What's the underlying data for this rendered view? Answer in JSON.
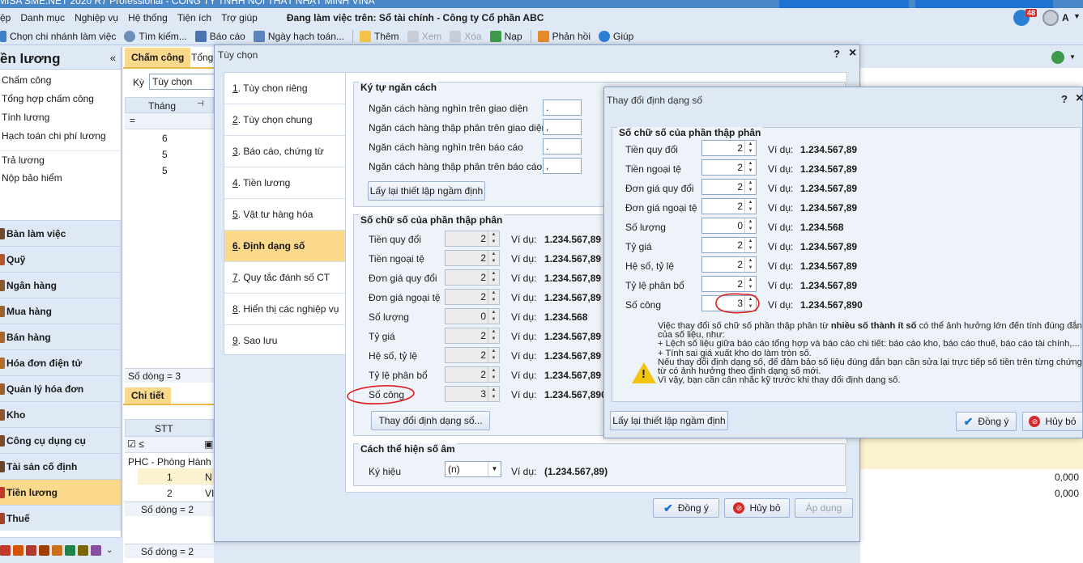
{
  "app": {
    "title_partial": "MISA SME.NET 2020 R7 Professional - CÔNG TY TNHH NỘI THẤT NHẬT MINH VINA"
  },
  "menubar": {
    "items": [
      "ệp",
      "Danh mục",
      "Nghiệp vụ",
      "Hệ thống",
      "Tiện ích",
      "Trợ giúp"
    ],
    "working_on": "Đang làm việc trên: Sổ tài chính - Công ty Cổ phần ABC",
    "notif_count": "48",
    "user": "A"
  },
  "toolbar": {
    "branch": "Chọn chi nhánh làm việc",
    "search": "Tìm kiếm...",
    "report": "Báo cáo",
    "post_date": "Ngày hạch toán...",
    "add": "Thêm",
    "view": "Xem",
    "delete": "Xóa",
    "load": "Nạp",
    "feedback": "Phản hồi",
    "help": "Giúp"
  },
  "left_panel": {
    "title": "ền lương",
    "collapse": "«",
    "links": [
      "Chấm công",
      "Tổng hợp chấm công",
      "Tính lương",
      "Hạch toán chi phí lương",
      "Trả lương",
      "Nộp bảo hiểm"
    ],
    "nav": [
      "Bàn làm việc",
      "Quỹ",
      "Ngân hàng",
      "Mua hàng",
      "Bán hàng",
      "Hóa đơn điện tử",
      "Quản lý hóa đơn",
      "Kho",
      "Công cụ dụng cụ",
      "Tài sản cố định",
      "Tiền lương",
      "Thuế"
    ],
    "selected_nav": "Tiền lương"
  },
  "mid": {
    "tab_active": "Chấm công",
    "tab_other": "Tổng",
    "period_label": "Kỳ",
    "period_value": "Tùy chọn",
    "col_month": "Tháng",
    "rows": [
      "6",
      "5",
      "5"
    ],
    "row_count": "Số dòng = 3",
    "detail_tab": "Chi tiết",
    "col_stt": "STT",
    "group": "PHC - Phòng Hành",
    "detail_rows": [
      {
        "stt": "1",
        "c": "N"
      },
      {
        "stt": "2",
        "c": "VI"
      }
    ],
    "detail_count": "Số dòng = 2",
    "footer_count": "Số dòng = 2"
  },
  "right_strip": {
    "v1": "0,000",
    "v2": "0,000"
  },
  "dialog_options": {
    "title": "Tùy chọn",
    "help": "?",
    "close": "×",
    "tabs": [
      {
        "num": "1",
        "label": ". Tùy chọn riêng"
      },
      {
        "num": "2",
        "label": ". Tùy chọn chung"
      },
      {
        "num": "3",
        "label": ". Báo cáo, chứng từ"
      },
      {
        "num": "4",
        "label": ". Tiền lương"
      },
      {
        "num": "5",
        "label": ". Vật tư hàng hóa"
      },
      {
        "num": "6",
        "label": ". Định dạng số"
      },
      {
        "num": "7",
        "label": ". Quy tắc đánh số CT"
      },
      {
        "num": "8",
        "label": ". Hiển thị các nghiệp vụ"
      },
      {
        "num": "9",
        "label": ". Sao lưu"
      }
    ],
    "separator_group": {
      "title": "Ký tự ngăn cách",
      "rows": [
        {
          "label": "Ngăn cách hàng nghìn trên giao diện",
          "value": "."
        },
        {
          "label": "Ngăn cách hàng thập phân trên giao diện",
          "value": ","
        },
        {
          "label": "Ngăn cách hàng nghìn trên báo cáo",
          "value": "."
        },
        {
          "label": "Ngăn cách hàng thập phân trên báo cáo",
          "value": ","
        }
      ],
      "reset_button": "Lấy lại thiết lập ngầm định"
    },
    "decimal_group": {
      "title": "Số chữ số của phần thập phân",
      "example_label": "Ví dụ:",
      "rows": [
        {
          "label": "Tiền quy đổi",
          "value": "2",
          "example": "1.234.567,89"
        },
        {
          "label": "Tiền ngoại tệ",
          "value": "2",
          "example": "1.234.567,89"
        },
        {
          "label": "Đơn giá quy đổi",
          "value": "2",
          "example": "1.234.567,89"
        },
        {
          "label": "Đơn giá ngoại tệ",
          "value": "2",
          "example": "1.234.567,89"
        },
        {
          "label": "Số lượng",
          "value": "0",
          "example": "1.234.568"
        },
        {
          "label": "Tỷ giá",
          "value": "2",
          "example": "1.234.567,89"
        },
        {
          "label": "Hệ số, tỷ lệ",
          "value": "2",
          "example": "1.234.567,89"
        },
        {
          "label": "Tỷ lệ phân bổ",
          "value": "2",
          "example": "1.234.567,89"
        },
        {
          "label": "Số công",
          "value": "3",
          "example": "1.234.567,890"
        }
      ],
      "change_button": "Thay đổi định dạng số..."
    },
    "negative_group": {
      "title": "Cách thể hiện số âm",
      "symbol_label": "Ký hiệu",
      "symbol_value": "(n)",
      "example_label": "Ví dụ:",
      "example": "(1.234.567,89)"
    },
    "ok": "Đồng ý",
    "cancel": "Hủy bỏ",
    "apply": "Áp dụng"
  },
  "dialog_format": {
    "title": "Thay đổi định dạng số",
    "help": "?",
    "close": "×",
    "group_title": "Số chữ số của phần thập phân",
    "example_label": "Ví dụ:",
    "rows": [
      {
        "label": "Tiền quy đổi",
        "value": "2",
        "example": "1.234.567,89"
      },
      {
        "label": "Tiền ngoại tệ",
        "value": "2",
        "example": "1.234.567,89"
      },
      {
        "label": "Đơn giá quy đổi",
        "value": "2",
        "example": "1.234.567,89"
      },
      {
        "label": "Đơn giá ngoại tệ",
        "value": "2",
        "example": "1.234.567,89"
      },
      {
        "label": "Số lượng",
        "value": "0",
        "example": "1.234.568"
      },
      {
        "label": "Tỷ giá",
        "value": "2",
        "example": "1.234.567,89"
      },
      {
        "label": "Hệ số, tỷ lệ",
        "value": "2",
        "example": "1.234.567,89"
      },
      {
        "label": "Tỷ lệ phân bổ",
        "value": "2",
        "example": "1.234.567,89"
      },
      {
        "label": "Số công",
        "value": "3",
        "example": "1.234.567,890"
      }
    ],
    "warning_icon": "warning-icon",
    "warning_lines": [
      {
        "pre": "Việc thay đổi số chữ số phần thập phân từ ",
        "bold": "nhiều số thành ít số",
        "post": " có thể ảnh hưởng lớn đến tính đúng đắn"
      },
      {
        "pre": "của số liệu, như:",
        "bold": "",
        "post": ""
      },
      {
        "pre": "+ Lệch số liệu giữa báo cáo tổng hợp và báo cáo chi tiết: báo cáo kho, báo cáo thuế, báo cáo tài chính,...",
        "bold": "",
        "post": ""
      },
      {
        "pre": "+ Tính sai giá xuất kho do làm tròn số.",
        "bold": "",
        "post": ""
      },
      {
        "pre": "Nếu thay đổi định dạng số, để đảm bảo số liệu đúng đắn bạn cần sửa lại trực tiếp số tiền trên từng chứng",
        "bold": "",
        "post": ""
      },
      {
        "pre": "từ có ảnh hưởng theo định dạng số mới.",
        "bold": "",
        "post": ""
      },
      {
        "pre": "Vì vậy, bạn cần cân nhắc kỹ trước khi thay đổi định dạng số.",
        "bold": "",
        "post": ""
      }
    ],
    "reset_button": "Lấy lại thiết lập ngầm định",
    "ok": "Đồng ý",
    "cancel": "Hủy bỏ"
  },
  "colors": {
    "accent": "#1e73d2",
    "selected": "#fbd98c",
    "annotation_red": "#e11d1d",
    "panel_bg": "#dfe8f5"
  }
}
